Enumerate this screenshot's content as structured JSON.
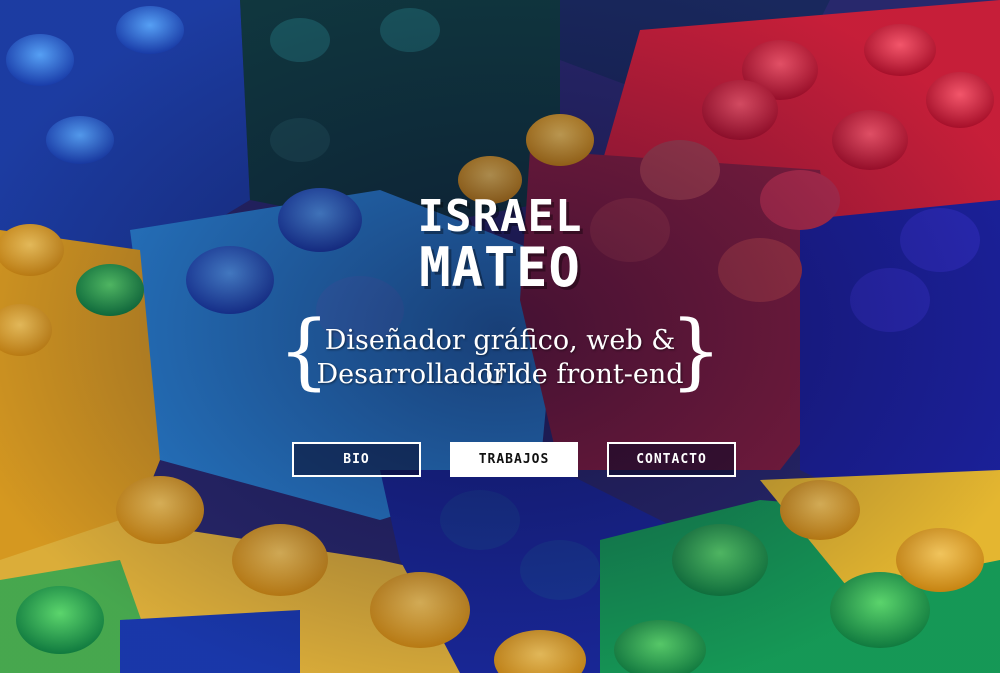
{
  "hero": {
    "name_line1": "ISRAEL",
    "name_line2": "MATEO",
    "tagline": {
      "open_brace": "{",
      "line1": "Diseñador gráfico, web & UI",
      "line2": "Desarrollador de front-end",
      "close_brace": "}"
    },
    "background": "lego-bricks-photo"
  },
  "nav": {
    "bio": "BIO",
    "trabajos": "TRABAJOS",
    "contacto": "CONTACTO",
    "active": "trabajos"
  },
  "colors": {
    "text": "#ffffff",
    "active_button_bg": "#ffffff",
    "active_button_text": "#111111"
  }
}
